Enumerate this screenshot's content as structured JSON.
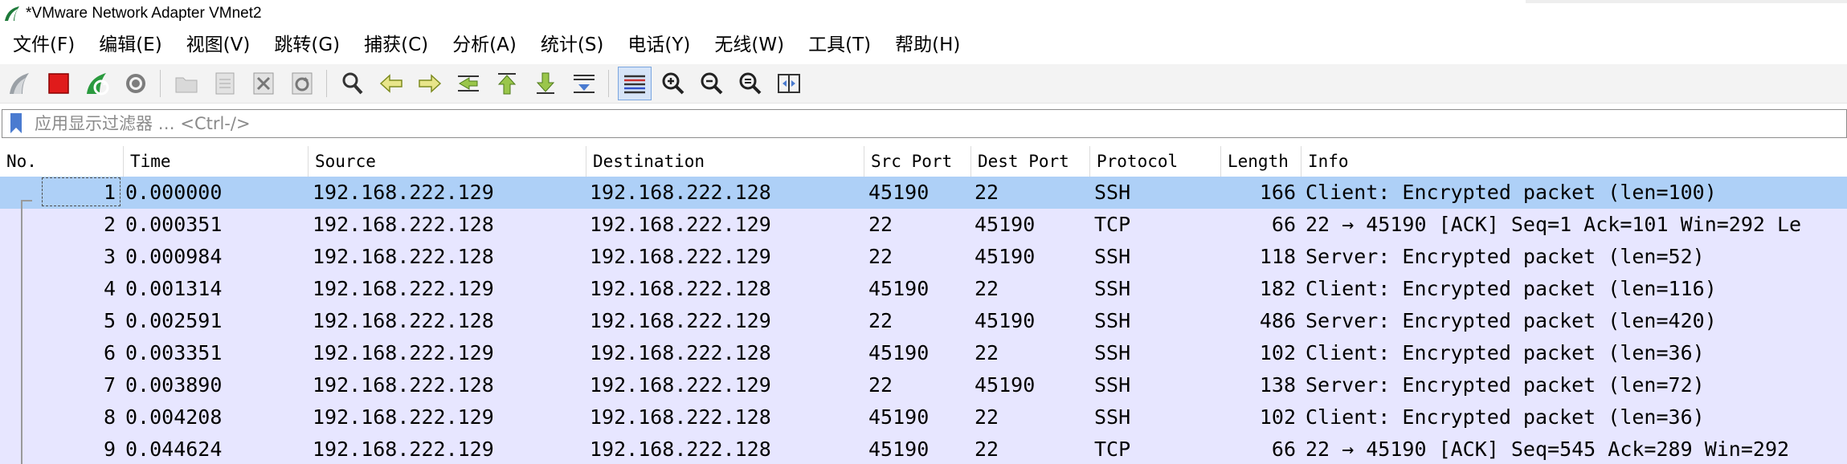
{
  "window": {
    "title": "*VMware Network Adapter VMnet2"
  },
  "menu": [
    {
      "label": "文件(F)",
      "name": "menu-file"
    },
    {
      "label": "编辑(E)",
      "name": "menu-edit"
    },
    {
      "label": "视图(V)",
      "name": "menu-view"
    },
    {
      "label": "跳转(G)",
      "name": "menu-go"
    },
    {
      "label": "捕获(C)",
      "name": "menu-capture"
    },
    {
      "label": "分析(A)",
      "name": "menu-analyze"
    },
    {
      "label": "统计(S)",
      "name": "menu-statistics"
    },
    {
      "label": "电话(Y)",
      "name": "menu-telephony"
    },
    {
      "label": "无线(W)",
      "name": "menu-wireless"
    },
    {
      "label": "工具(T)",
      "name": "menu-tools"
    },
    {
      "label": "帮助(H)",
      "name": "menu-help"
    }
  ],
  "toolbar": {
    "icons": [
      "start-capture-icon",
      "stop-capture-icon",
      "restart-capture-icon",
      "capture-options-icon",
      "open-file-icon",
      "save-file-icon",
      "close-file-icon",
      "reload-file-icon",
      "find-packet-icon",
      "go-back-icon",
      "go-forward-icon",
      "go-to-packet-icon",
      "go-first-packet-icon",
      "go-last-packet-icon",
      "auto-scroll-icon",
      "colorize-icon",
      "zoom-in-icon",
      "zoom-out-icon",
      "zoom-normal-icon",
      "resize-columns-icon"
    ]
  },
  "filter": {
    "placeholder": "应用显示过滤器 … <Ctrl-/>",
    "value": ""
  },
  "columns": [
    "No.",
    "Time",
    "Source",
    "Destination",
    "Src Port",
    "Dest Port",
    "Protocol",
    "Length",
    "Info"
  ],
  "colors": {
    "selected_row": "#aed0f7",
    "row_bg": "#e7e6ff"
  },
  "packets": [
    {
      "no": "1",
      "time": "0.000000",
      "source": "192.168.222.129",
      "destination": "192.168.222.128",
      "src_port": "45190",
      "dest_port": "22",
      "protocol": "SSH",
      "length": "166",
      "info": "Client: Encrypted packet (len=100)"
    },
    {
      "no": "2",
      "time": "0.000351",
      "source": "192.168.222.128",
      "destination": "192.168.222.129",
      "src_port": "22",
      "dest_port": "45190",
      "protocol": "TCP",
      "length": "66",
      "info": "22 → 45190 [ACK] Seq=1 Ack=101 Win=292 Le"
    },
    {
      "no": "3",
      "time": "0.000984",
      "source": "192.168.222.128",
      "destination": "192.168.222.129",
      "src_port": "22",
      "dest_port": "45190",
      "protocol": "SSH",
      "length": "118",
      "info": "Server: Encrypted packet (len=52)"
    },
    {
      "no": "4",
      "time": "0.001314",
      "source": "192.168.222.129",
      "destination": "192.168.222.128",
      "src_port": "45190",
      "dest_port": "22",
      "protocol": "SSH",
      "length": "182",
      "info": "Client: Encrypted packet (len=116)"
    },
    {
      "no": "5",
      "time": "0.002591",
      "source": "192.168.222.128",
      "destination": "192.168.222.129",
      "src_port": "22",
      "dest_port": "45190",
      "protocol": "SSH",
      "length": "486",
      "info": "Server: Encrypted packet (len=420)"
    },
    {
      "no": "6",
      "time": "0.003351",
      "source": "192.168.222.129",
      "destination": "192.168.222.128",
      "src_port": "45190",
      "dest_port": "22",
      "protocol": "SSH",
      "length": "102",
      "info": "Client: Encrypted packet (len=36)"
    },
    {
      "no": "7",
      "time": "0.003890",
      "source": "192.168.222.128",
      "destination": "192.168.222.129",
      "src_port": "22",
      "dest_port": "45190",
      "protocol": "SSH",
      "length": "138",
      "info": "Server: Encrypted packet (len=72)"
    },
    {
      "no": "8",
      "time": "0.004208",
      "source": "192.168.222.129",
      "destination": "192.168.222.128",
      "src_port": "45190",
      "dest_port": "22",
      "protocol": "SSH",
      "length": "102",
      "info": "Client: Encrypted packet (len=36)"
    },
    {
      "no": "9",
      "time": "0.044624",
      "source": "192.168.222.129",
      "destination": "192.168.222.128",
      "src_port": "45190",
      "dest_port": "22",
      "protocol": "TCP",
      "length": "66",
      "info": "22 → 45190 [ACK] Seq=545 Ack=289 Win=292"
    }
  ],
  "selected_packet": "1"
}
